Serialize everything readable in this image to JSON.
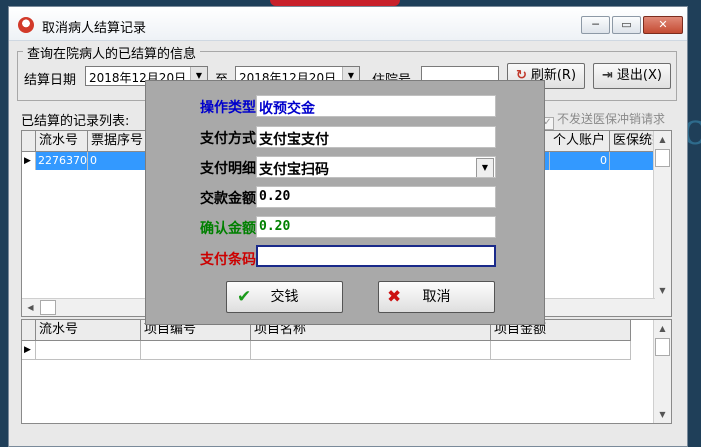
{
  "window": {
    "title": "取消病人结算记录",
    "minimize_glyph": "─",
    "maximize_glyph": "▭",
    "close_glyph": "✕"
  },
  "query": {
    "group_title": "查询在院病人的已结算的信息",
    "settle_date_label": "结算日期",
    "date_from": "2018年12月20日",
    "to_label": "至",
    "date_to": "2018年12月20日",
    "inpatient_no_label": "住院号",
    "inpatient_no_value": "",
    "refresh_label": "刷新(R)",
    "exit_label": "退出(X)"
  },
  "records": {
    "section_label": "已结算的记录列表:",
    "no_cancel_checkbox_label": "不发送医保冲销请求",
    "columns_left": [
      "流水号",
      "票据序号"
    ],
    "columns_right": [
      "个人账户",
      "医保统筹"
    ],
    "rows": [
      {
        "serial": "2276370",
        "receipt_no": "0",
        "personal_account": "0",
        "insurance_pool": ""
      }
    ]
  },
  "items": {
    "columns": [
      "流水号",
      "项目编号",
      "项目名称",
      "项目金额"
    ],
    "rows": [
      {
        "serial": "",
        "item_code": "",
        "item_name": "",
        "item_amount": ""
      }
    ]
  },
  "payment_dialog": {
    "op_type_label": "操作类型",
    "op_type_value": "收预交金",
    "pay_method_label": "支付方式",
    "pay_method_value": "支付宝支付",
    "pay_detail_label": "支付明细",
    "pay_detail_value": "支付宝扫码",
    "pay_amount_label": "交款金额",
    "pay_amount_value": "0.20",
    "confirm_amount_label": "确认金额",
    "confirm_amount_value": "0.20",
    "barcode_label": "支付条码",
    "barcode_value": "",
    "pay_button_label": "交钱",
    "cancel_button_label": "取消"
  },
  "colors": {
    "label_blue": "#0000cc",
    "label_green": "#008000",
    "label_red": "#cc0000",
    "selection": "#3399ff"
  },
  "icons": [
    "app-icon",
    "refresh-icon",
    "exit-icon",
    "checkmark-icon",
    "cross-icon",
    "dropdown-arrow-icon"
  ]
}
